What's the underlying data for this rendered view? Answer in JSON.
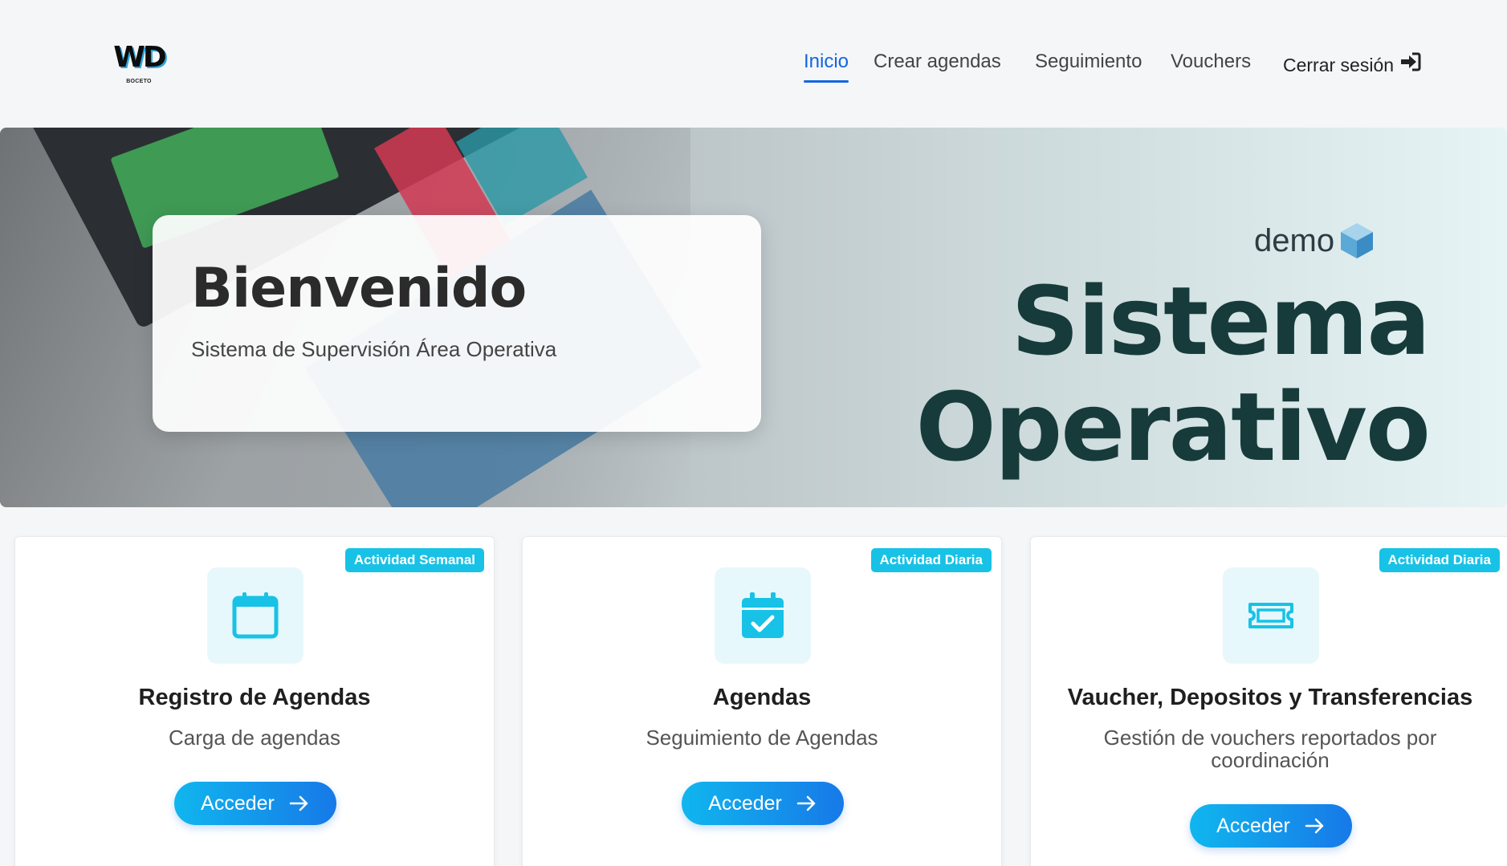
{
  "brand": {
    "logo_text": "WD",
    "logo_sub": "BOCETO"
  },
  "nav": {
    "items": [
      {
        "label": "Inicio",
        "active": true
      },
      {
        "label": "Crear agendas",
        "active": false
      },
      {
        "label": "Seguimiento",
        "active": false
      },
      {
        "label": "Vouchers",
        "active": false
      }
    ],
    "logout_label": "Cerrar sesión",
    "logout_icon": "sign-in-icon"
  },
  "hero": {
    "welcome_title": "Bienvenido",
    "welcome_subtitle": "Sistema de Supervisión Área Operativa",
    "demo_label": "demo",
    "banner_line1": "Sistema",
    "banner_line2": "Operativo"
  },
  "cards": [
    {
      "badge": "Actividad Semanal",
      "icon": "calendar-icon",
      "title": "Registro de Agendas",
      "description": "Carga de agendas",
      "button": "Acceder"
    },
    {
      "badge": "Actividad Diaria",
      "icon": "calendar-check-icon",
      "title": "Agendas",
      "description": "Seguimiento de Agendas",
      "button": "Acceder"
    },
    {
      "badge": "Actividad Diaria",
      "icon": "ticket-icon",
      "title": "Vaucher, Depositos y Transferencias",
      "description": "Gestión de vouchers reportados por coordinación",
      "button": "Acceder"
    }
  ],
  "colors": {
    "accent": "#1366e0",
    "badge": "#18c2e6",
    "button_start": "#10b6ee",
    "button_end": "#1779e8",
    "icon": "#18c2e6",
    "banner_text": "#163b3a"
  }
}
